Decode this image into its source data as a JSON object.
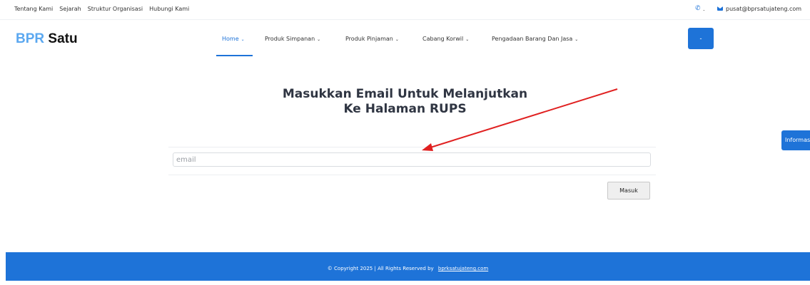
{
  "topbar": {
    "links": [
      "Tentang Kami",
      "Sejarah",
      "Struktur Organisasi",
      "Hubungi Kami"
    ],
    "phone_icon": "phone-icon",
    "phone_text": ".",
    "mail_icon": "mail-icon",
    "email": "pusat@bprsatujateng.com"
  },
  "brand": {
    "part1": "BPR",
    "part2": "Satu"
  },
  "nav": {
    "items": [
      {
        "label": "Home",
        "active": true
      },
      {
        "label": "Produk Simpanan"
      },
      {
        "label": "Produk Pinjaman"
      },
      {
        "label": "Cabang Korwil"
      },
      {
        "label": "Pengadaan Barang Dan Jasa"
      }
    ],
    "chevron": "⌄",
    "button_label": "-"
  },
  "main": {
    "title_line1": "Masukkan Email Untuk Melanjutkan",
    "title_line2": "Ke Halaman RUPS",
    "email_placeholder": "email",
    "email_value": "",
    "submit_label": "Masuk"
  },
  "side_tab": {
    "label": "Informas"
  },
  "footer": {
    "text": "© Copyright 2025 | All Rights Reserved by",
    "link": "bprksatujateng.com"
  },
  "colors": {
    "accent": "#1e73d8",
    "brand_light": "#5ba8f0",
    "arrow": "#e02020"
  }
}
